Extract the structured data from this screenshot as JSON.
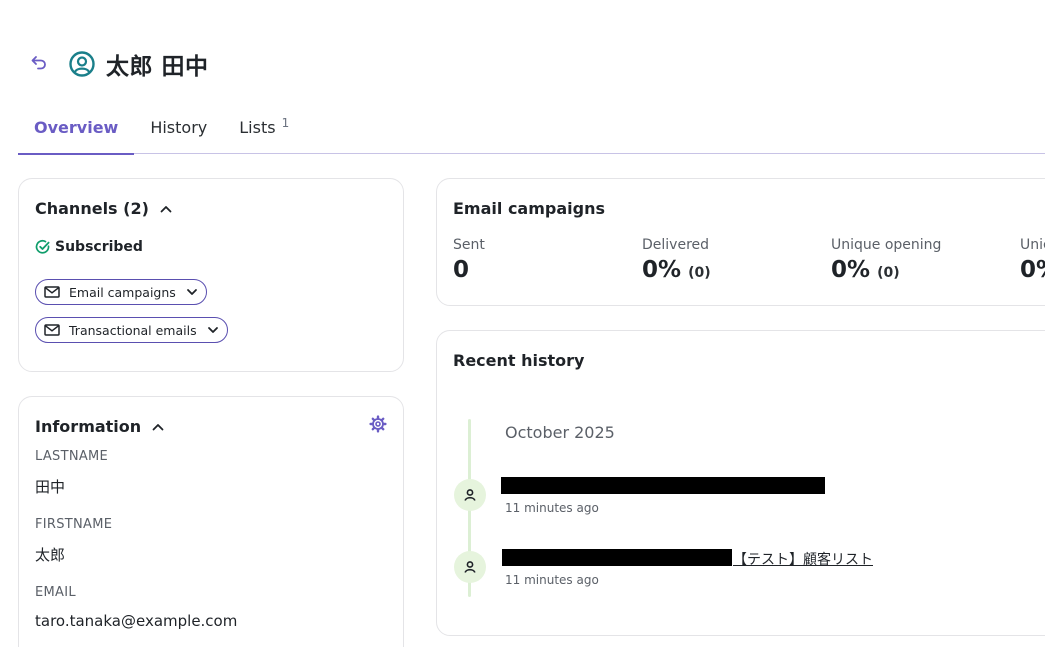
{
  "header": {
    "back_icon": "undo-arrow-icon",
    "user_icon": "user-circle-icon",
    "name": "太郎 田中"
  },
  "tabs": [
    {
      "label": "Overview",
      "active": true
    },
    {
      "label": "History",
      "active": false
    },
    {
      "label": "Lists",
      "count": "1",
      "active": false
    }
  ],
  "channels": {
    "title": "Channels (2)",
    "status": "Subscribed",
    "items": [
      {
        "label": "Email campaigns"
      },
      {
        "label": "Transactional emails"
      }
    ]
  },
  "information": {
    "title": "Information",
    "fields": [
      {
        "label": "LASTNAME",
        "value": "田中"
      },
      {
        "label": "FIRSTNAME",
        "value": "太郎"
      },
      {
        "label": "EMAIL",
        "value": "taro.tanaka@example.com"
      }
    ]
  },
  "email_campaigns": {
    "title": "Email campaigns",
    "stats": [
      {
        "label": "Sent",
        "value": "0",
        "sub": ""
      },
      {
        "label": "Delivered",
        "value": "0%",
        "sub": "(0)"
      },
      {
        "label": "Unique opening",
        "value": "0%",
        "sub": "(0)"
      },
      {
        "label": "Unic",
        "value": "0%",
        "sub": ""
      }
    ]
  },
  "recent_history": {
    "title": "Recent history",
    "month": "October 2025",
    "events": [
      {
        "link_text": "",
        "time": "11 minutes ago"
      },
      {
        "link_text": "【テスト】顧客リスト",
        "time": "11 minutes ago"
      }
    ]
  },
  "colors": {
    "accent": "#6a5cc4",
    "success": "#0f9d6b",
    "timeline": "#dcefd4"
  }
}
